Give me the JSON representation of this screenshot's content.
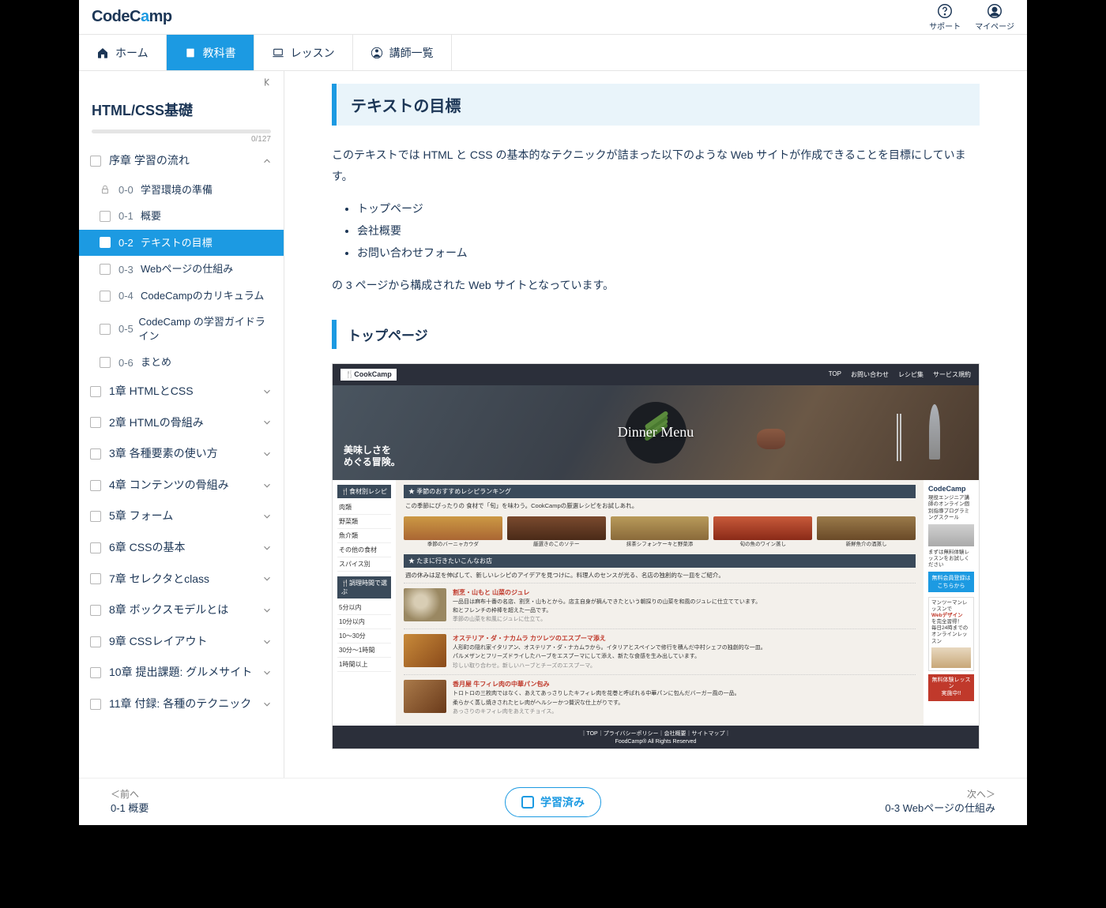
{
  "brand": {
    "name_pre": "CodeC",
    "name_accent": "a",
    "name_post": "mp"
  },
  "header_items": [
    {
      "label": "サポート"
    },
    {
      "label": "マイページ"
    }
  ],
  "nav": [
    {
      "label": "ホーム"
    },
    {
      "label": "教科書"
    },
    {
      "label": "レッスン"
    },
    {
      "label": "講師一覧"
    }
  ],
  "course_title": "HTML/CSS基礎",
  "progress": "0/127",
  "chapters": [
    {
      "title": "序章 学習の流れ",
      "expanded": true,
      "lessons": [
        {
          "num": "0-0",
          "title": "学習環境の準備",
          "locked": true
        },
        {
          "num": "0-1",
          "title": "概要"
        },
        {
          "num": "0-2",
          "title": "テキストの目標",
          "active": true
        },
        {
          "num": "0-3",
          "title": "Webページの仕組み"
        },
        {
          "num": "0-4",
          "title": "CodeCampのカリキュラム"
        },
        {
          "num": "0-5",
          "title": "CodeCamp の学習ガイドライン"
        },
        {
          "num": "0-6",
          "title": "まとめ"
        }
      ]
    },
    {
      "title": "1章 HTMLとCSS"
    },
    {
      "title": "2章 HTMLの骨組み"
    },
    {
      "title": "3章 各種要素の使い方"
    },
    {
      "title": "4章 コンテンツの骨組み"
    },
    {
      "title": "5章 フォーム"
    },
    {
      "title": "6章 CSSの基本"
    },
    {
      "title": "7章 セレクタとclass"
    },
    {
      "title": "8章 ボックスモデルとは"
    },
    {
      "title": "9章 CSSレイアウト"
    },
    {
      "title": "10章 提出課題: グルメサイト"
    },
    {
      "title": "11章 付録: 各種のテクニック"
    }
  ],
  "page": {
    "title": "テキストの目標",
    "intro": "このテキストでは HTML と CSS の基本的なテクニックが詰まった以下のような Web サイトが作成できることを目標にしています。",
    "bullets": [
      "トップページ",
      "会社概要",
      "お問い合わせフォーム"
    ],
    "outro": "の 3 ページから構成された Web サイトとなっています。",
    "sub": "トップページ"
  },
  "mock": {
    "logo": "🍴CookCamp",
    "nav": [
      "TOP",
      "お問い合わせ",
      "レシピ集",
      "サービス規約"
    ],
    "hero_menu": "Dinner Menu",
    "hero_tag1": "美味しさを",
    "hero_tag2": "めぐる冒険。",
    "side1_head": "🍴食材別レシピ",
    "side1_items": [
      "肉類",
      "野菜類",
      "魚介類",
      "その他の食材",
      "スパイス別"
    ],
    "side2_head": "🍴調理時間で選ぶ",
    "side2_items": [
      "5分以内",
      "10分以内",
      "10～30分",
      "30分～1時間",
      "1時間以上"
    ],
    "sec1_head": "★ 季節のおすすめレシピランキング",
    "sec1_desc": "この季節にぴったりの 食材で「旬」を味わう。CookCampの厳選レシピをお試しあれ。",
    "thumbs": [
      {
        "cap": "季節のバーニャカウダ"
      },
      {
        "cap": "厳選きのこのソテー"
      },
      {
        "cap": "抹茶シフォンケーキと野菜添"
      },
      {
        "cap": "旬の魚のワイン蒸し"
      },
      {
        "cap": "新鮮魚介の酒蒸し"
      }
    ],
    "sec2_head": "★ たまに行きたいこんなお店",
    "sec2_desc": "週の休みは足を伸ばして、新しいレシピのアイデアを見つけに。料理人のセンスが光る、名店の独創的な一皿をご紹介。",
    "articles": [
      {
        "title": "割烹・山もと 山菜のジュレ",
        "desc": "一品目は麻布十番の名店、割烹・山もとから。店主自身が摘んできたという朝採りの山菜を和風のジュレに仕立てています。",
        "desc2": "和とフレンチの枠棒を超えた一品です。",
        "cap": "季節の山菜を和風にジュレに仕立て。"
      },
      {
        "title": "オステリア・ダ・ナカムラ カツレツのエスプーマ添え",
        "desc": "人形町の隠れ家イタリアン、オステリア・ダ・ナカムラから。イタリアとスペインで修行を積んだ中村シェフの独創的な一皿。",
        "desc2": "パルメザンとフリーズドライしたハーブをエスプーマにして添え、新たな食感を生み出しています。",
        "cap": "珍しい取り合わせ。新しいハーブとチーズのエスプーマ。"
      },
      {
        "title": "香月屋 牛フィレ肉の中華パン包み",
        "desc": "トロトロの三枚肉ではなく、あえてあっさりしたキフィレ肉を花巻と呼ばれる中華パンに包んだバーガー風の一品。",
        "desc2": "柔らかく蒸し焼きされたヒレ肉がヘルシーかつ贅沢な仕上がりです。",
        "cap": "あっさりのキフィレ肉をあえてチョイス。"
      }
    ],
    "right": {
      "logo": "CodeCamp",
      "txt": "現役エンジニア講師のオンライン個別指導プログラミングスクール",
      "note": "まずは無料体験レッスンをお試しください",
      "btn": "無料会員登録はこちらから",
      "ad1": "マンツーマンレッスンで",
      "ad1_hl": "Webデザイン",
      "ad1b": "を完全習得！",
      "ad1c": "毎日24時までのオンラインレッスン",
      "ad2a": "無料体験レッスン",
      "ad2b": "実施中!!"
    },
    "footer_links": "｜TOP｜プライバシーポリシー｜会社概要｜サイトマップ｜",
    "footer_copy": "FoodCamp® All Rights Reserved"
  },
  "footnav": {
    "prev_hint": "＜前へ",
    "prev": "0-1 概要",
    "done": "学習済み",
    "next_hint": "次へ＞",
    "next": "0-3 Webページの仕組み"
  }
}
